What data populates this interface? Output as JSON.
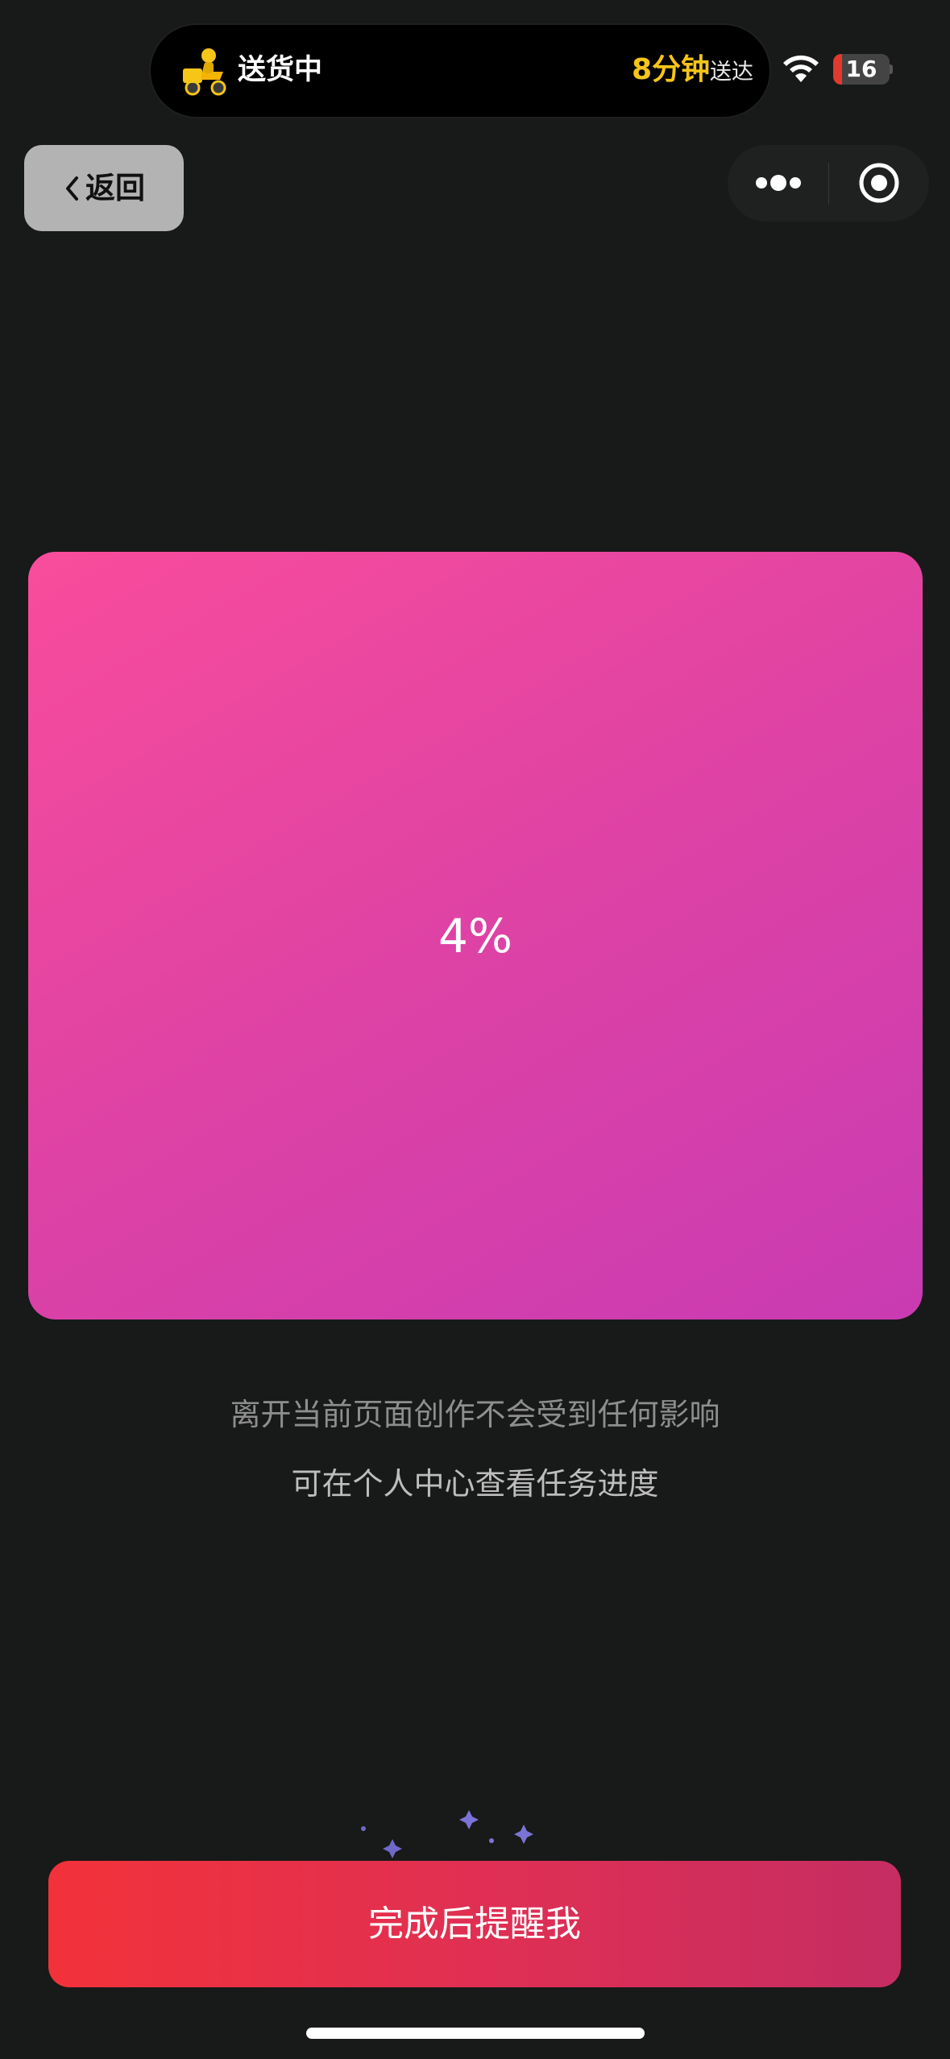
{
  "status_bar": {
    "delivery_status": "送货中",
    "eta_minutes": "8分钟",
    "eta_suffix": "送达",
    "battery_level": "16",
    "battery_percent": 16,
    "accent_color": "#f5c518"
  },
  "nav": {
    "back_label": "返回"
  },
  "progress": {
    "text": "4%",
    "value": 4,
    "gradient_from": "#f94c9c",
    "gradient_to": "#c93bb3"
  },
  "notices": {
    "line1": "离开当前页面创作不会受到任何影响",
    "line2": "可在个人中心查看任务进度"
  },
  "actions": {
    "remind_label": "完成后提醒我",
    "remind_color": "#f2323a"
  },
  "icons": {
    "courier": "courier-scooter-icon",
    "wifi": "wifi-icon",
    "back": "chevron-left-icon",
    "more": "more-dots-icon",
    "close": "close-target-icon"
  }
}
